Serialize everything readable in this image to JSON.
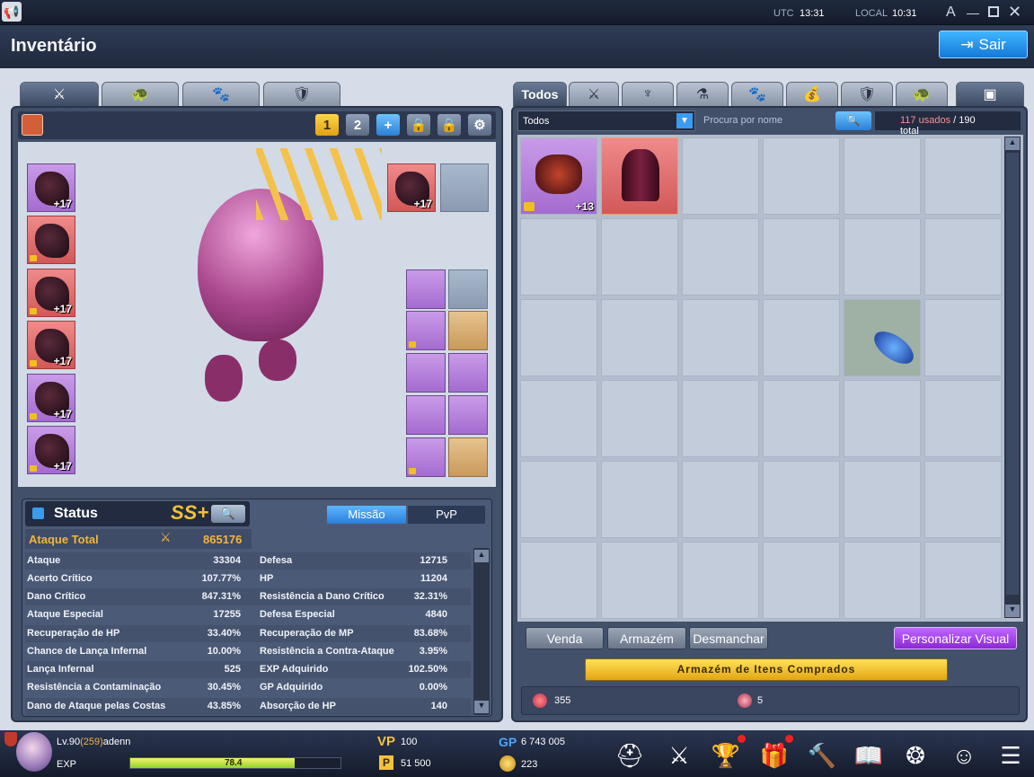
{
  "topbar": {
    "utc_label": "UTC",
    "utc_time": "13:31",
    "local_label": "LOCAL",
    "local_time": "10:31",
    "font_icon": "A"
  },
  "header": {
    "title": "Inventário",
    "exit_label": "Sair"
  },
  "left_tabs": [
    "sword-icon",
    "turtle-icon",
    "paw-icon",
    "shield-icon"
  ],
  "equip": {
    "preset1": "1",
    "preset2": "2",
    "add": "+",
    "left_slots": [
      "+17",
      "",
      "+17",
      "+17",
      "+17",
      "+17"
    ],
    "top_slot": "+17"
  },
  "status": {
    "title": "Status",
    "rank": "SS+",
    "mode_mission": "Missão",
    "mode_pvp": "PvP",
    "total_label": "Ataque Total",
    "total_value": "865176",
    "rows": [
      [
        "Ataque",
        "33304",
        "Defesa",
        "12715"
      ],
      [
        "Acerto Crítico",
        "107.77%",
        "HP",
        "11204"
      ],
      [
        "Dano Crítico",
        "847.31%",
        "Resistência a Dano Crítico",
        "32.31%"
      ],
      [
        "Ataque Especial",
        "17255",
        "Defesa Especial",
        "4840"
      ],
      [
        "Recuperação de HP",
        "33.40%",
        "Recuperação de MP",
        "83.68%"
      ],
      [
        "Chance de Lança Infernal",
        "10.00%",
        "Resistência a Contra-Ataque",
        "3.95%"
      ],
      [
        "Lança Infernal",
        "525",
        "EXP Adquirido",
        "102.50%"
      ],
      [
        "Resistência a Contaminação",
        "30.45%",
        "GP Adquirido",
        "0.00%"
      ],
      [
        "Dano de Ataque pelas Costas",
        "43.85%",
        "Absorção de HP",
        "140"
      ]
    ]
  },
  "inventory": {
    "tab_all": "Todos",
    "filter": "Todos",
    "search_placeholder": "Procura por nome",
    "used": "117 usados",
    "total": "/ 190 total",
    "item1_level": "+13",
    "sell": "Venda",
    "storage": "Armazém",
    "dismantle": "Desmanchar",
    "customize": "Personalizar Visual",
    "purchased": "Armazém de Itens Comprados",
    "currency1": "355",
    "currency2": "5"
  },
  "player": {
    "level": "Lv.90",
    "sublevel": "(259)",
    "name": "adenn",
    "exp_label": "EXP",
    "exp_value": "78.4",
    "exp_fraction": 0.784,
    "vp_label": "VP",
    "vp": "100",
    "p_value": "51 500",
    "gp_label": "GP",
    "gp": "6 743 005",
    "coin": "223"
  }
}
